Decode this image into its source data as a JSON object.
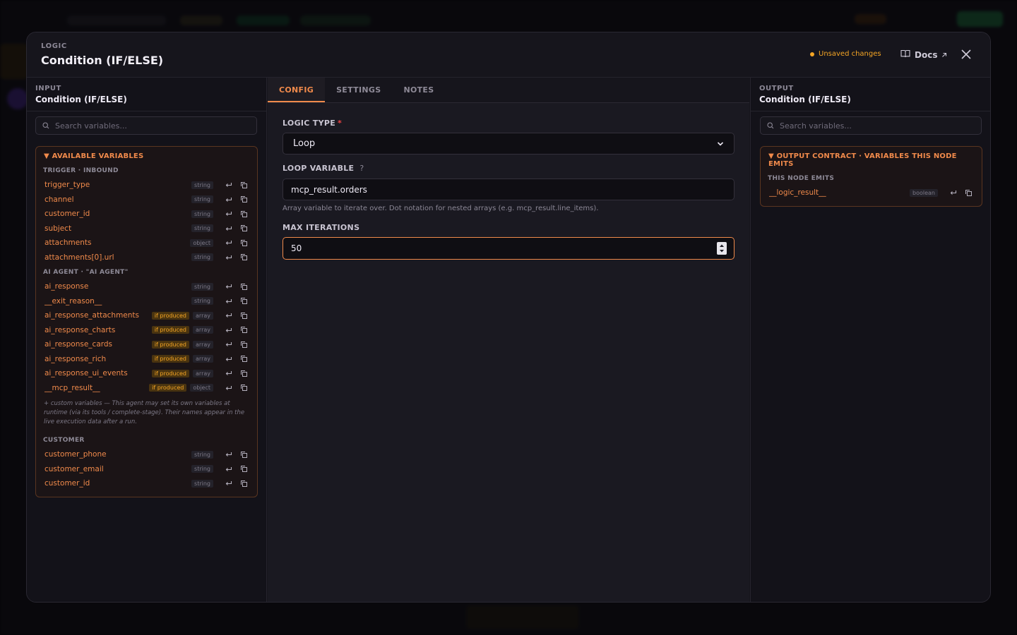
{
  "modal": {
    "kicker": "LOGIC",
    "title": "Condition (IF/ELSE)",
    "unsaved": "Unsaved changes",
    "docs": "Docs"
  },
  "input": {
    "kicker": "INPUT",
    "title": "Condition (IF/ELSE)",
    "search_placeholder": "Search variables...",
    "box_title": "AVAILABLE VARIABLES",
    "groups": {
      "trigger": "TRIGGER · INBOUND",
      "agent": "AI AGENT · \"AI AGENT\"",
      "customer": "CUSTOMER"
    },
    "trigger_vars": [
      {
        "name": "trigger_type",
        "type": "string"
      },
      {
        "name": "channel",
        "type": "string"
      },
      {
        "name": "customer_id",
        "type": "string"
      },
      {
        "name": "subject",
        "type": "string"
      },
      {
        "name": "attachments",
        "type": "object"
      },
      {
        "name": "attachments[0].url",
        "type": "string"
      }
    ],
    "agent_vars": [
      {
        "name": "ai_response",
        "type": "string",
        "produced": ""
      },
      {
        "name": "__exit_reason__",
        "type": "string",
        "produced": ""
      },
      {
        "name": "ai_response_attachments",
        "type": "array",
        "produced": "if produced"
      },
      {
        "name": "ai_response_charts",
        "type": "array",
        "produced": "if produced"
      },
      {
        "name": "ai_response_cards",
        "type": "array",
        "produced": "if produced"
      },
      {
        "name": "ai_response_rich",
        "type": "array",
        "produced": "if produced"
      },
      {
        "name": "ai_response_ui_events",
        "type": "array",
        "produced": "if produced"
      },
      {
        "name": "__mcp_result__",
        "type": "object",
        "produced": "if produced"
      }
    ],
    "note": "+ custom variables — This agent may set its own variables at runtime (via its tools / complete-stage). Their names appear in the live execution data after a run.",
    "customer_vars": [
      {
        "name": "customer_phone",
        "type": "string"
      },
      {
        "name": "customer_email",
        "type": "string"
      },
      {
        "name": "customer_id",
        "type": "string"
      }
    ]
  },
  "tabs": [
    "CONFIG",
    "SETTINGS",
    "NOTES"
  ],
  "config": {
    "logic_type_label": "LOGIC TYPE",
    "logic_type_value": "Loop",
    "loop_var_label": "LOOP VARIABLE",
    "loop_var_help": "?",
    "loop_var_value": "mcp_result.orders",
    "loop_var_hint": "Array variable to iterate over. Dot notation for nested arrays (e.g. mcp_result.line_items).",
    "max_iter_label": "MAX ITERATIONS",
    "max_iter_value": "50"
  },
  "output": {
    "kicker": "OUTPUT",
    "title": "Condition (IF/ELSE)",
    "search_placeholder": "Search variables...",
    "box_title": "OUTPUT CONTRACT · VARIABLES THIS NODE EMITS",
    "group": "THIS NODE EMITS",
    "vars": [
      {
        "name": "__logic_result__",
        "type": "boolean"
      }
    ]
  },
  "colors": {
    "accent": "#f08a4b",
    "warning": "#f5a524",
    "required": "#ef4444"
  }
}
